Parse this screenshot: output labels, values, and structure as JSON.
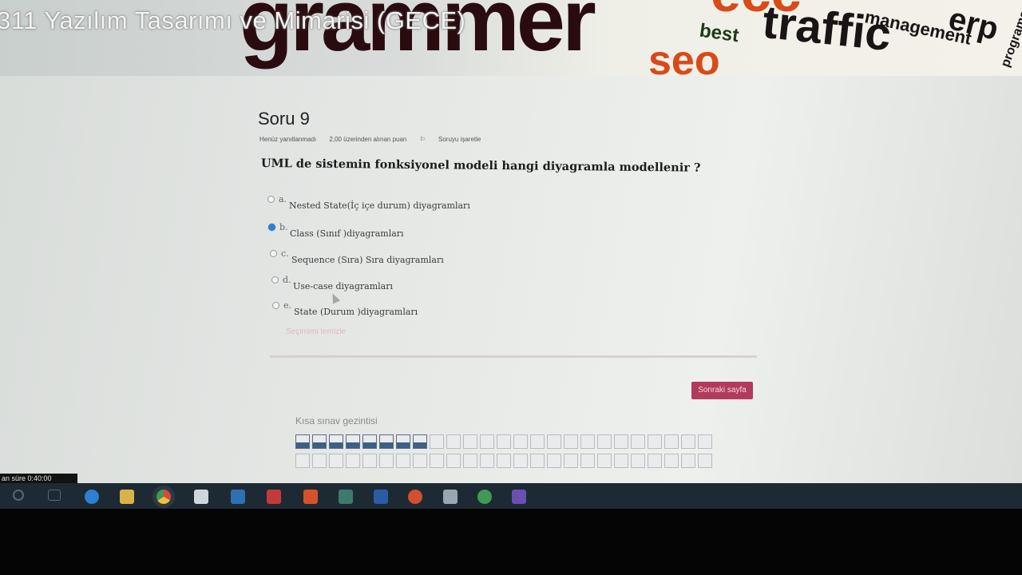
{
  "course": {
    "title": "311 Yazılım Tasarımı ve Mimarisi (GECE)"
  },
  "banner_words": [
    {
      "text": "grammer",
      "color": "#2a0c10"
    },
    {
      "text": "traffic",
      "color": "#1b1416"
    },
    {
      "text": "management",
      "color": "#1a1416"
    },
    {
      "text": "erp",
      "color": "#1a1416"
    },
    {
      "text": "programs",
      "color": "#1a1416"
    },
    {
      "text": "best",
      "color": "#1f3a18"
    },
    {
      "text": "ecc",
      "color": "#d84a18"
    },
    {
      "text": "seo",
      "color": "#d84a18"
    }
  ],
  "question": {
    "number": "Soru 9",
    "status": "Henüz yanıtlanmadı",
    "points": "2,00 üzerinden alınan puan",
    "flag": "Soruyu işaretle",
    "text": "UML de sistemin fonksiyonel modeli hangi diyagramla modellenir ?",
    "options": [
      {
        "letter": "a.",
        "label": "Nested State(İç içe durum) diyagramları",
        "selected": false
      },
      {
        "letter": "b.",
        "label": "Class (Sınıf )diyagramları",
        "selected": true
      },
      {
        "letter": "c.",
        "label": "Sequence (Sıra) Sıra diyagramları",
        "selected": false
      },
      {
        "letter": "d.",
        "label": "Use-case diyagramları",
        "selected": false
      },
      {
        "letter": "e.",
        "label": "State (Durum )diyagramları",
        "selected": false
      }
    ],
    "clear_choice": "Seçimimi temizle"
  },
  "next_button": "Sonraki sayfa",
  "quiz_nav": {
    "title": "Kısa sınav gezintisi",
    "answered_count": 8,
    "total": 50
  },
  "timer": "an süre 0:40:00"
}
